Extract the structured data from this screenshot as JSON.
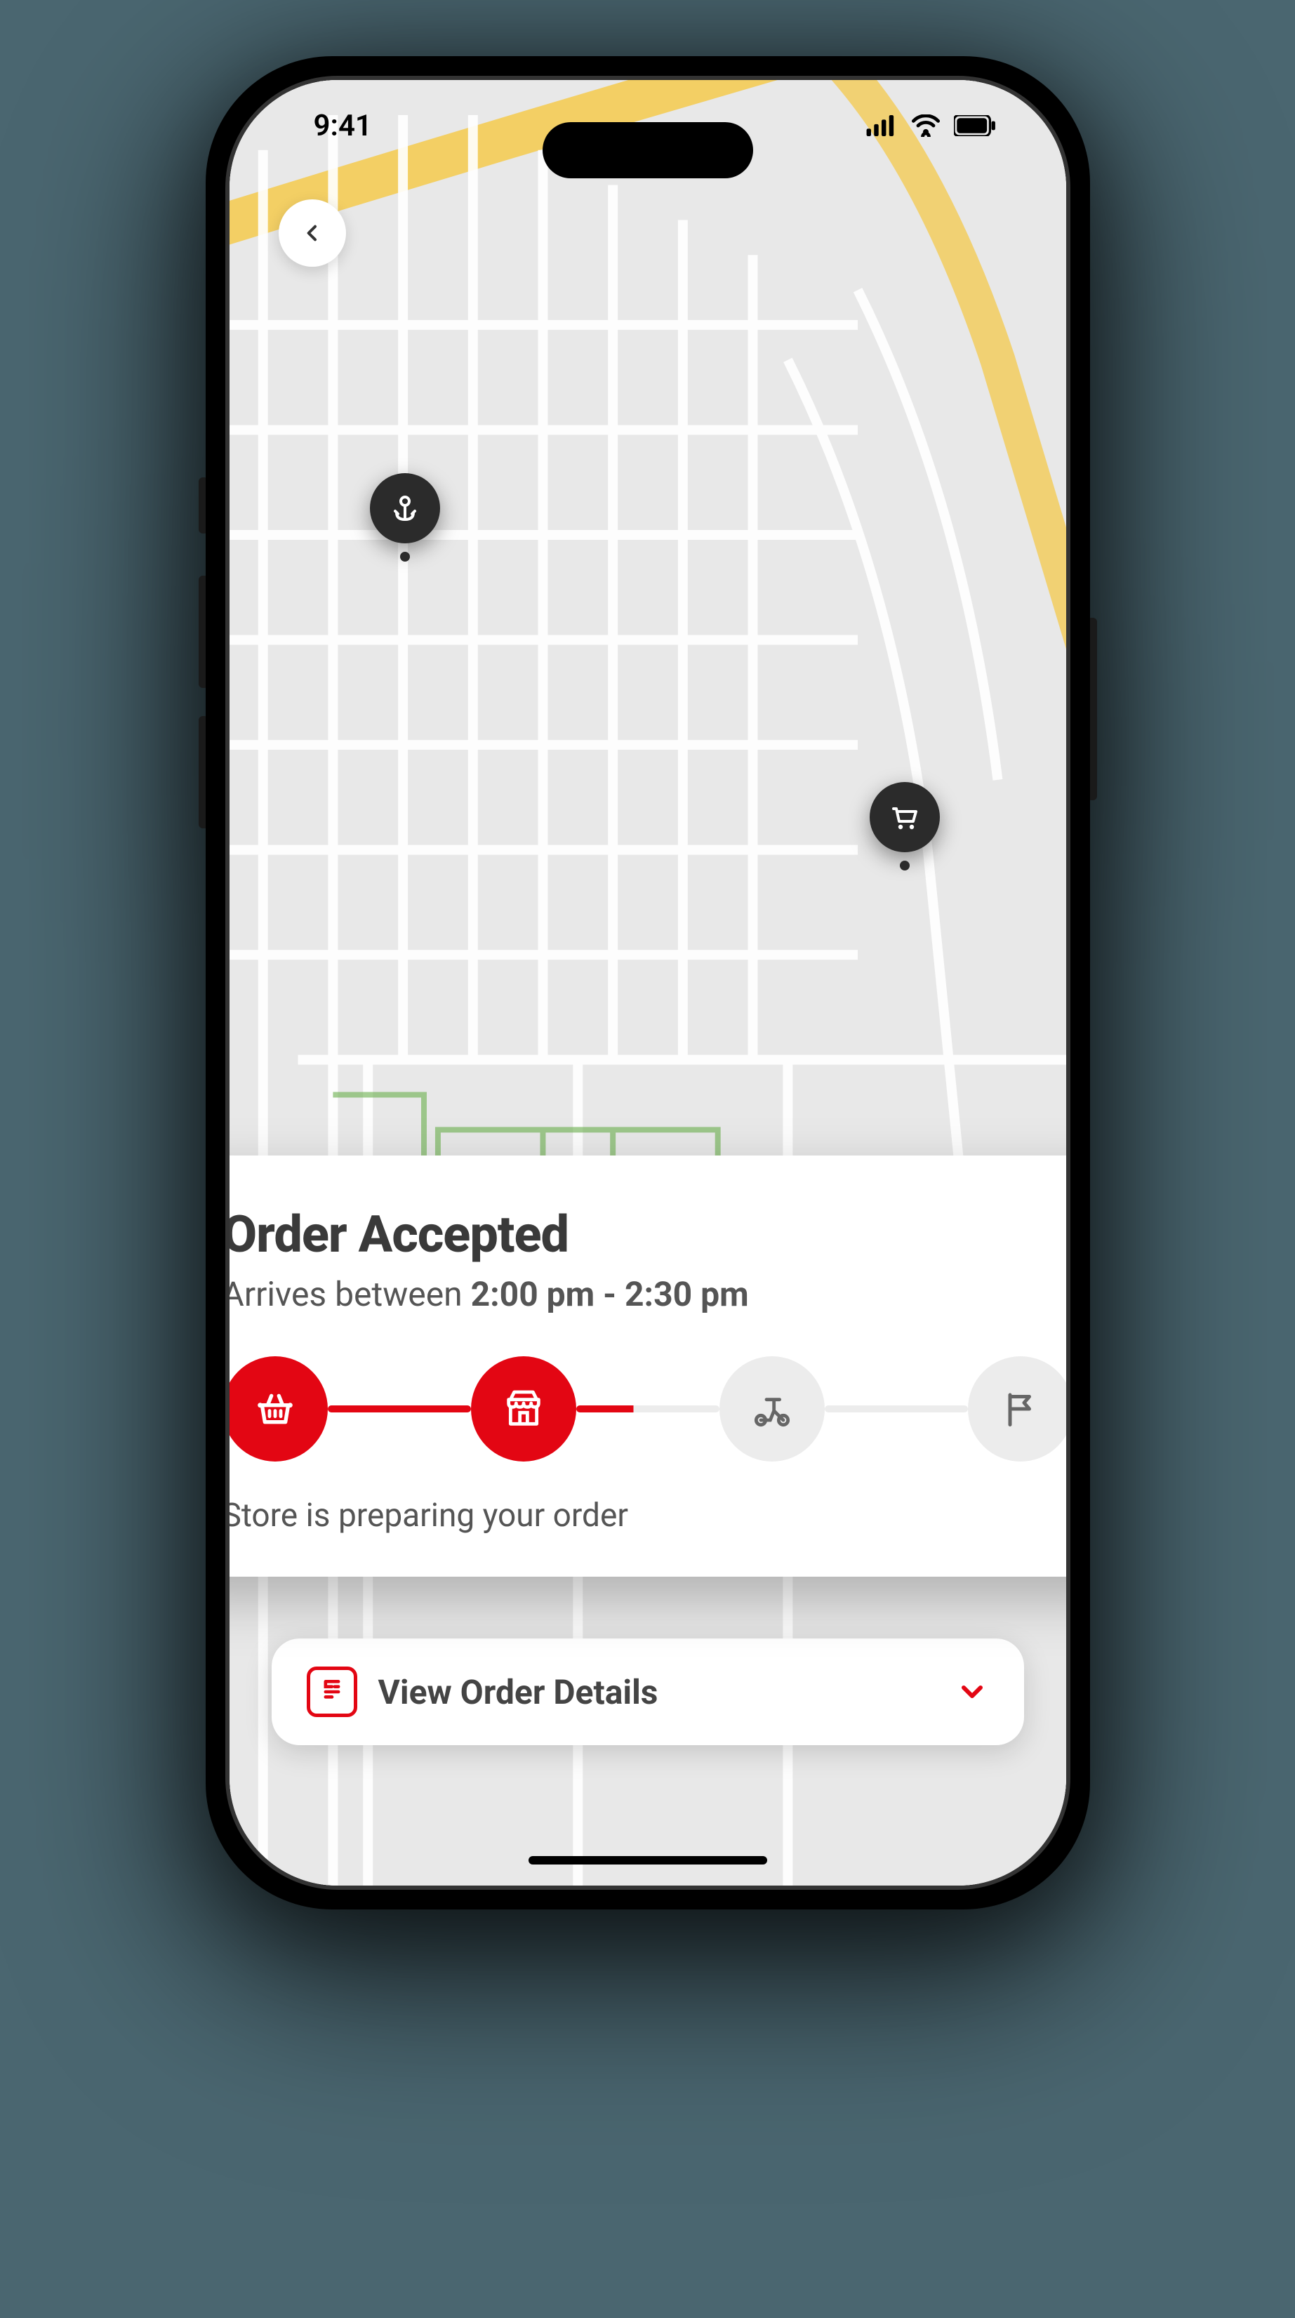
{
  "status_bar": {
    "time": "9:41"
  },
  "map": {
    "origin_icon": "anchor-pin",
    "destination_icon": "cart-pin"
  },
  "card": {
    "title": "Order Accepted",
    "arrival_prefix": "Arrives between ",
    "arrival_window": "2:00 pm - 2:30 pm",
    "status_text": "Store is preparing your order",
    "steps": [
      {
        "name": "basket",
        "state": "active"
      },
      {
        "name": "store",
        "state": "active"
      },
      {
        "name": "delivery",
        "state": "inactive"
      },
      {
        "name": "complete",
        "state": "inactive"
      }
    ]
  },
  "details_button": {
    "label": "View Order Details"
  }
}
